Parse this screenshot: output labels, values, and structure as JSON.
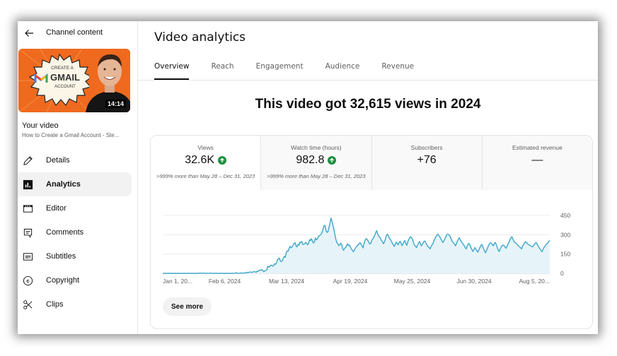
{
  "sidebar": {
    "back_icon": "arrow-left-icon",
    "title": "Channel content",
    "thumbnail": {
      "badge_line1": "CREATE A",
      "badge_line2": "GMAIL",
      "badge_line3": "ACCOUNT",
      "duration": "14:14"
    },
    "your_video_label": "Your video",
    "video_title": "How to Create a Gmail Account - Ste...",
    "items": [
      {
        "label": "Details",
        "icon": "pencil-icon",
        "active": false
      },
      {
        "label": "Analytics",
        "icon": "analytics-icon",
        "active": true
      },
      {
        "label": "Editor",
        "icon": "clapperboard-icon",
        "active": false
      },
      {
        "label": "Comments",
        "icon": "comment-icon",
        "active": false
      },
      {
        "label": "Subtitles",
        "icon": "subtitles-icon",
        "active": false
      },
      {
        "label": "Copyright",
        "icon": "copyright-icon",
        "active": false
      },
      {
        "label": "Clips",
        "icon": "scissors-icon",
        "active": false
      }
    ]
  },
  "main": {
    "title": "Video analytics",
    "tabs": [
      {
        "label": "Overview",
        "active": true
      },
      {
        "label": "Reach",
        "active": false
      },
      {
        "label": "Engagement",
        "active": false
      },
      {
        "label": "Audience",
        "active": false
      },
      {
        "label": "Revenue",
        "active": false
      }
    ],
    "headline": "This video got 32,615 views in 2024",
    "metrics": [
      {
        "label": "Views",
        "value": "32.6K",
        "trend": "up",
        "sub": ">999% more than May 28 – Dec 31, 2023"
      },
      {
        "label": "Watch time (hours)",
        "value": "982.8",
        "trend": "up",
        "sub": ">999% more than May 28 – Dec 31, 2023"
      },
      {
        "label": "Subscribers",
        "value": "+76",
        "trend": "",
        "sub": ""
      },
      {
        "label": "Estimated revenue",
        "value": "—",
        "trend": "",
        "sub": ""
      }
    ],
    "see_more_label": "See more",
    "colors": {
      "line": "#3ea6c9",
      "fill": "#e6f4f9",
      "trend_up": "#1e8e3e"
    }
  },
  "chart_data": {
    "type": "area",
    "title": "Views",
    "xlabel": "",
    "ylabel": "",
    "ylim": [
      0,
      450
    ],
    "yticks": [
      0,
      150,
      300,
      450
    ],
    "yaxis_position": "right",
    "grid": true,
    "x_tick_labels": [
      "Jan 1, 20...",
      "Feb 6, 2024",
      "Mar 13, 2024",
      "Apr 19, 2024",
      "May 25, 2024",
      "Jun 30, 2024",
      "Aug 5, 20..."
    ],
    "x_tick_day_index": [
      0,
      36,
      72,
      109,
      145,
      181,
      217
    ],
    "series": [
      {
        "name": "Views",
        "values": [
          0,
          0,
          0,
          0,
          0,
          0,
          0,
          0,
          0,
          0,
          0,
          0,
          0,
          0,
          0,
          0,
          0,
          0,
          0,
          0,
          0,
          0,
          0,
          0,
          0,
          0,
          0,
          0,
          0,
          0,
          0,
          0,
          0,
          0,
          0,
          0,
          0,
          0,
          3,
          2,
          0,
          2,
          3,
          1,
          0,
          0,
          2,
          0,
          0,
          1,
          2,
          0,
          0,
          0,
          0,
          0,
          0,
          0,
          0,
          0,
          0,
          0,
          0,
          0,
          0,
          0,
          0,
          0,
          0,
          0,
          0,
          0,
          0,
          0,
          2,
          4,
          3,
          1,
          0,
          0,
          3,
          4,
          2,
          1,
          3,
          5,
          4,
          8,
          6,
          9,
          11,
          8,
          9,
          11,
          14,
          12,
          8,
          17,
          15,
          22,
          26,
          24,
          30,
          20,
          13,
          20,
          22,
          28,
          55,
          50,
          52,
          64,
          62,
          56,
          60,
          75,
          70,
          80,
          105,
          115,
          118,
          95,
          92,
          98,
          120,
          132,
          125,
          160,
          175,
          172,
          195,
          210,
          198,
          205,
          220,
          230,
          240,
          215,
          205,
          225,
          218,
          242,
          238,
          248,
          225,
          226,
          230,
          241,
          232,
          222,
          235,
          262,
          255,
          270,
          248,
          236,
          245,
          275,
          260,
          268,
          285,
          292,
          298,
          305,
          320,
          350,
          372,
          370,
          330,
          318,
          325,
          360,
          390,
          430,
          405,
          375,
          342,
          300,
          265,
          240,
          230,
          215,
          220,
          235,
          225,
          190,
          180,
          195,
          200,
          215,
          230,
          215,
          220,
          205,
          190,
          180,
          168,
          178,
          195,
          205,
          215,
          222,
          230,
          238,
          226,
          212,
          198,
          232,
          255,
          270,
          265,
          255,
          240,
          228,
          235,
          258,
          268,
          280,
          296,
          318,
          332,
          305,
          290,
          284,
          270,
          255,
          245,
          230,
          245,
          268,
          295,
          305,
          292,
          276,
          265,
          250,
          236,
          222,
          210,
          225,
          242,
          234,
          222,
          238,
          250,
          236,
          216,
          228,
          245,
          255,
          230,
          218,
          245,
          265,
          276,
          286,
          275,
          260,
          236,
          218,
          210,
          200,
          220,
          235,
          248,
          228,
          214,
          226,
          240,
          252,
          248,
          230,
          218,
          206,
          200,
          190,
          210,
          222,
          234,
          256,
          270,
          285,
          298,
          305,
          292,
          282,
          268,
          254,
          240,
          250,
          265,
          285,
          300,
          305,
          300,
          295,
          278,
          258,
          246,
          236,
          228,
          214,
          230,
          252,
          265,
          276,
          260,
          248,
          236,
          225,
          215,
          200,
          190,
          210,
          228,
          232,
          218,
          200,
          184,
          170,
          185,
          200,
          190,
          175,
          165,
          180,
          198,
          215,
          225,
          210,
          190,
          172,
          160,
          180,
          198,
          215,
          230,
          238,
          232,
          222,
          215,
          235,
          240,
          222,
          200,
          180,
          170,
          190,
          205,
          215,
          220,
          215,
          205,
          195,
          210,
          228,
          240,
          262,
          275,
          285,
          268,
          250,
          240,
          236,
          228,
          220,
          212,
          205,
          200,
          190,
          210,
          225,
          235,
          246,
          240,
          232,
          224,
          220,
          215,
          210,
          205,
          212,
          225,
          232,
          240,
          228,
          212,
          200,
          190,
          178,
          168,
          185,
          200,
          210,
          222,
          230,
          236,
          250,
          255
        ]
      }
    ]
  }
}
